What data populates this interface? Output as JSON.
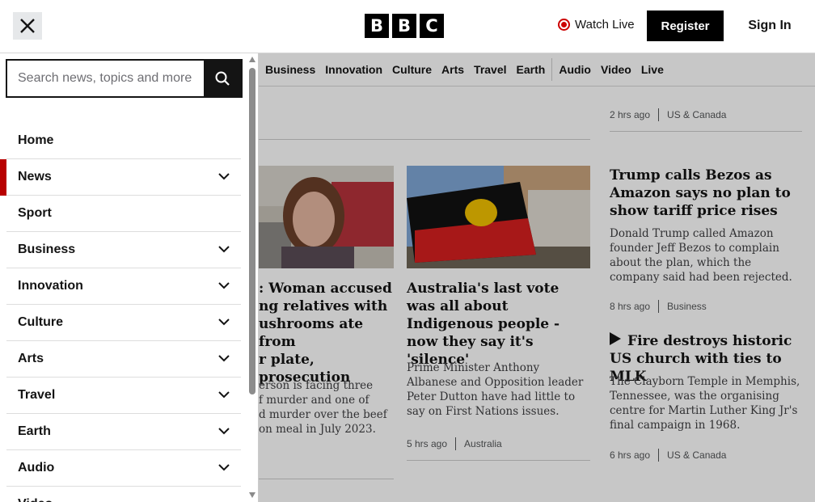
{
  "header": {
    "watch_live": "Watch Live",
    "register": "Register",
    "sign_in": "Sign In",
    "logo_letters": [
      "B",
      "B",
      "C"
    ]
  },
  "search": {
    "placeholder": "Search news, topics and more"
  },
  "menu": {
    "items": [
      {
        "label": "Home",
        "has_chevron": false,
        "active": false
      },
      {
        "label": "News",
        "has_chevron": true,
        "active": true
      },
      {
        "label": "Sport",
        "has_chevron": false,
        "active": false
      },
      {
        "label": "Business",
        "has_chevron": true,
        "active": false
      },
      {
        "label": "Innovation",
        "has_chevron": true,
        "active": false
      },
      {
        "label": "Culture",
        "has_chevron": true,
        "active": false
      },
      {
        "label": "Arts",
        "has_chevron": true,
        "active": false
      },
      {
        "label": "Travel",
        "has_chevron": true,
        "active": false
      },
      {
        "label": "Earth",
        "has_chevron": true,
        "active": false
      },
      {
        "label": "Audio",
        "has_chevron": true,
        "active": false
      },
      {
        "label": "Video",
        "has_chevron": false,
        "active": false
      }
    ]
  },
  "nav": {
    "items": [
      "Business",
      "Innovation",
      "Culture",
      "Arts",
      "Travel",
      "Earth",
      "Audio",
      "Video",
      "Live"
    ]
  },
  "stories": {
    "top_right_meta": {
      "time": "2 hrs ago",
      "section": "US & Canada"
    },
    "woman": {
      "title": "Woman accused of killing relatives with mushrooms ate from her plate, prosecution says",
      "title_lines": [
        ": Woman accused",
        "ng relatives with",
        "ushrooms ate from",
        "r plate, prosecution"
      ],
      "desc_lines": [
        "erson is facing three",
        "f murder and one of",
        "d murder over the beef",
        "on meal in July 2023."
      ]
    },
    "australia": {
      "title": "Australia's last vote was all about Indigenous people - now they say it's 'silence'",
      "desc": "Prime Minister Anthony Albanese and Opposition leader Peter Dutton have had little to say on First Nations issues.",
      "time": "5 hrs ago",
      "section": "Australia"
    },
    "trump": {
      "title": "Trump calls Bezos as Amazon says no plan to show tariff price rises",
      "desc": "Donald Trump called Amazon founder Jeff Bezos to complain about the plan, which the company said had been rejected.",
      "time": "8 hrs ago",
      "section": "Business"
    },
    "fire": {
      "title": "Fire destroys historic US church with ties to MLK",
      "desc": "The Clayborn Temple in Memphis, Tennessee, was the organising centre for Martin Luther King Jr's final campaign in 1968.",
      "time": "6 hrs ago",
      "section": "US & Canada"
    }
  },
  "colors": {
    "accent_red": "#b80000",
    "live_red": "#cc0000"
  }
}
